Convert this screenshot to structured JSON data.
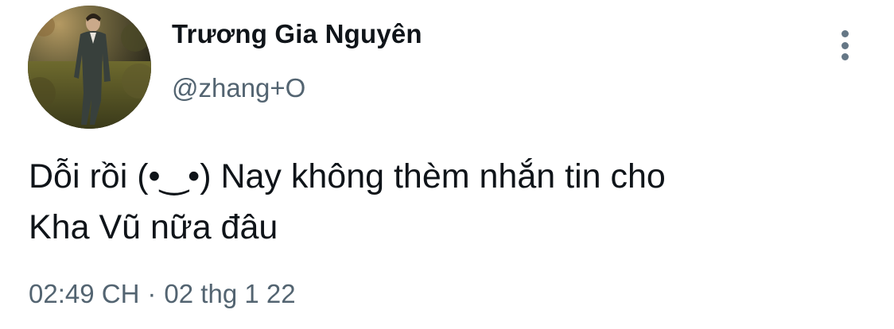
{
  "author": {
    "display_name": "Trương Gia Nguyên",
    "handle": "@zhang+O"
  },
  "tweet": {
    "text_line_1": "Dỗi rồi (•‿•) Nay không thèm nhắn tin cho",
    "text_line_2": "Kha Vũ nữa đâu"
  },
  "meta": {
    "time": "02:49 CH",
    "separator": "·",
    "date": "02 thg 1 22"
  },
  "icons": {
    "more": "more-vertical-icon"
  },
  "colors": {
    "primary_text": "#0f1419",
    "secondary_text": "#536471",
    "icon": "#657786",
    "background": "#ffffff"
  }
}
